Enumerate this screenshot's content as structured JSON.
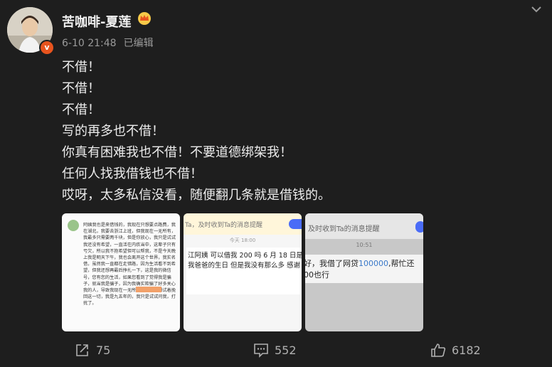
{
  "post": {
    "author": "苦咖啡-夏莲",
    "date": "6-10 21:48",
    "edited": "已编辑",
    "lines": [
      "不借！",
      "不借！",
      "不借！",
      "写的再多也不借！",
      "你真有困难我也不借！不要道德绑架我！",
      "任何人找我借钱也不借！",
      "哎呀，太多私信没看，随便翻几条就是借钱的。"
    ]
  },
  "images": {
    "img1": {
      "text": "阿姨我也是来借钱的，我现在只想要点路费，我在湖北，我要去浙江上班，但我现在一无所有，我最多只需要两千块，但是你放心，我只是试试我还没有希望，一直活在内疚当中，这辈子只有亏欠，所以我不抱希望但可以帮我，不是今天晚上我是明天下午，我也会离开这个世界，我实名借，虽然我一直都在走错路，因为生活看不到希望，但我还想再最后挣扎一下，这是我的微信号，您有您的生活，如果您看到了觉得我是骗子，就当我是骗子，因为我确实欺骗了好多关心我的人，导致我现在一无所有，所以我想试着挽回这一切，我是九五年的，我只是试试问我，打扰了。"
    },
    "img2": {
      "banner": "Ta，及时收到Ta的消息提醒",
      "time": "今天 18:00",
      "message": "江阿姨 可以借我 200 吗 6 月 18 日是我爸爸的生日 但是我没有那么多 感谢"
    },
    "img3": {
      "banner": "及时收到Ta的消息提醒",
      "time": "10:51",
      "message_before": "好，我借了网贷",
      "message_num": "100000",
      "message_after": ",帮忙还",
      "message_line2": "00也行"
    }
  },
  "actions": {
    "repost_count": "75",
    "comment_count": "552",
    "like_count": "6182"
  },
  "colors": {
    "background": "#1e1e1e",
    "badge": "#e8541e",
    "link_blue": "#4a6cf7"
  }
}
